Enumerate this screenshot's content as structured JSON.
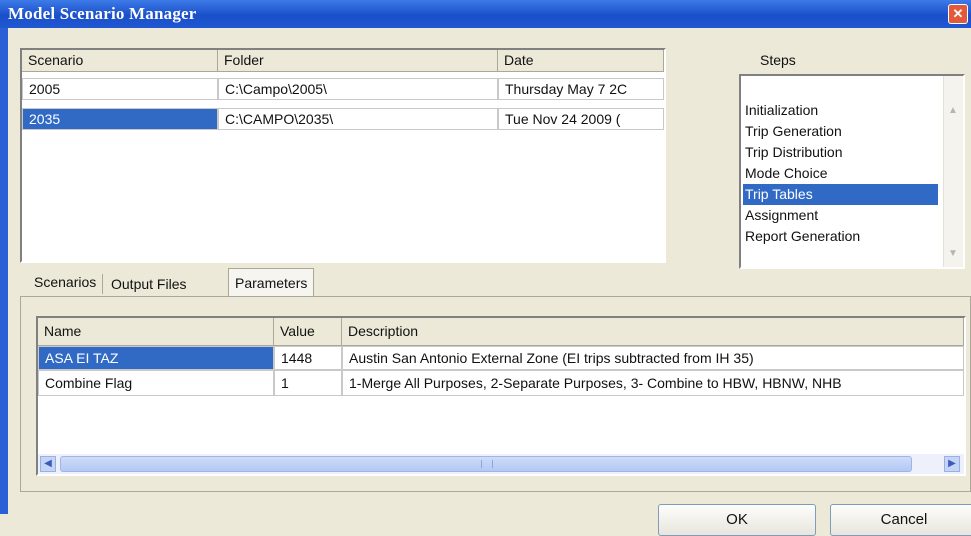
{
  "window": {
    "title": "Model Scenario Manager",
    "close_glyph": "✕"
  },
  "scenarios": {
    "columns": [
      "Scenario",
      "Folder",
      "Date"
    ],
    "rows": [
      {
        "scenario": "2005",
        "folder": "C:\\Campo\\2005\\",
        "date": "Thursday May 7 2C",
        "selected": false
      },
      {
        "scenario": "2035",
        "folder": "C:\\CAMPO\\2035\\",
        "date": "Tue Nov 24 2009 (",
        "selected": true
      }
    ]
  },
  "steps": {
    "label": "Steps",
    "items": [
      "Initialization",
      "Trip Generation",
      "Trip Distribution",
      "Mode Choice",
      "Trip Tables",
      "Assignment",
      "Report Generation"
    ],
    "selected": "Trip Tables"
  },
  "tabs": [
    {
      "label": "Scenarios",
      "active": false
    },
    {
      "label": "Output Files",
      "active": false
    },
    {
      "label": "Parameters",
      "active": true
    }
  ],
  "parameters": {
    "columns": [
      "Name",
      "Value",
      "Description"
    ],
    "rows": [
      {
        "name": "ASA EI TAZ",
        "value": "1448",
        "description": "Austin San Antonio External Zone (EI trips subtracted from IH 35)",
        "selected": true
      },
      {
        "name": "Combine Flag",
        "value": "1",
        "description": "1-Merge All Purposes, 2-Separate Purposes, 3- Combine to HBW, HBNW, NHB",
        "selected": false
      }
    ]
  },
  "buttons": {
    "ok": "OK",
    "cancel": "Cancel"
  },
  "icons": {
    "close": "close-icon",
    "scroll_left": "chevron-left-icon",
    "scroll_right": "chevron-right-icon",
    "scroll_up": "chevron-up-icon",
    "scroll_down": "chevron-down-icon"
  },
  "colors": {
    "title_bar": "#1a4fc9",
    "selection": "#316ac5",
    "dialog_bg": "#ece9d8"
  }
}
